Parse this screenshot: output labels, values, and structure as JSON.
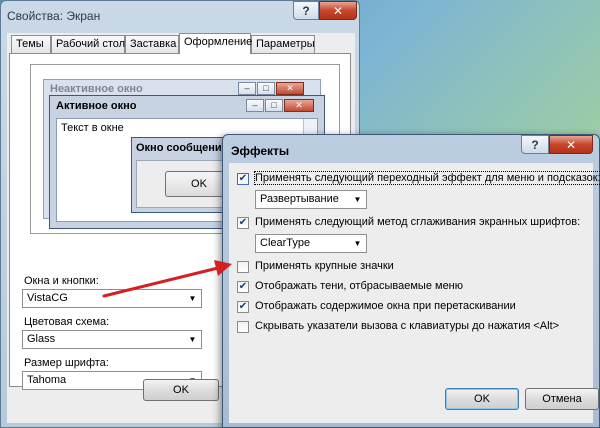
{
  "display_window": {
    "title": "Свойства: Экран",
    "title_buttons": {
      "help": "?",
      "close": "✕"
    },
    "tabs": [
      {
        "label": "Темы",
        "active": false
      },
      {
        "label": "Рабочий стол",
        "active": false
      },
      {
        "label": "Заставка",
        "active": false
      },
      {
        "label": "Оформление",
        "active": true
      },
      {
        "label": "Параметры",
        "active": false
      }
    ],
    "preview": {
      "inactive_title": "Неактивное окно",
      "active_title": "Активное окно",
      "body_text": "Текст в окне",
      "message_title": "Окно сообщения",
      "ok_label": "OK"
    },
    "windows_buttons": {
      "label": "Окна и кнопки:",
      "value": "VistaCG"
    },
    "color_scheme": {
      "label": "Цветовая схема:",
      "value": "Glass"
    },
    "font_size": {
      "label": "Размер шрифта:",
      "value": "Tahoma"
    },
    "ok_label": "OK"
  },
  "effects_dialog": {
    "title": "Эффекты",
    "title_buttons": {
      "help": "?",
      "close": "✕"
    },
    "options": [
      {
        "label": "Применять следующий переходный эффект для меню и подсказок:",
        "checked": true
      },
      {
        "label": "Применять следующий метод сглаживания экранных шрифтов:",
        "checked": true
      },
      {
        "label": "Применять крупные значки",
        "checked": false
      },
      {
        "label": "Отображать тени, отбрасываемые меню",
        "checked": true
      },
      {
        "label": "Отображать содержимое окна при перетаскивании",
        "checked": true
      },
      {
        "label": "Скрывать указатели вызова с клавиатуры до нажатия <Alt>",
        "checked": false
      }
    ],
    "transition_effect": "Развертывание",
    "smoothing_method": "ClearType",
    "ok_label": "OK",
    "cancel_label": "Отмена"
  },
  "colors": {
    "annotation_arrow": "#d42020"
  }
}
